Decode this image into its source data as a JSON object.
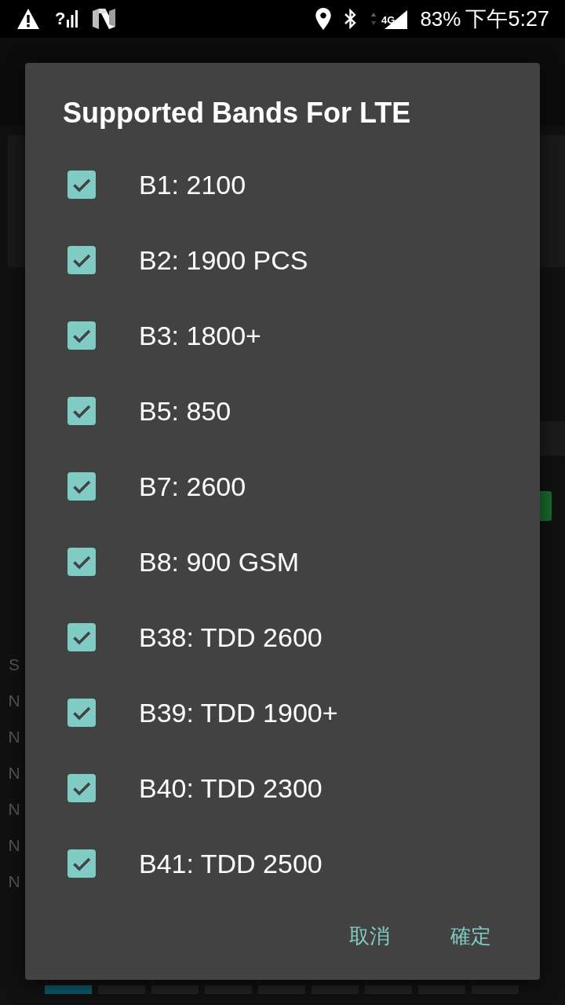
{
  "status_bar": {
    "signal_mark": "?",
    "network_type": "4G",
    "battery": "83%",
    "time": "下午5:27"
  },
  "background": {
    "side_letters": [
      "S",
      "N",
      "N",
      "N",
      "N",
      "N",
      "N"
    ],
    "page_indicators": [
      {
        "selected": true
      },
      {
        "selected": false
      },
      {
        "selected": false
      },
      {
        "selected": false
      },
      {
        "selected": false
      },
      {
        "selected": false
      },
      {
        "selected": false
      },
      {
        "selected": false
      },
      {
        "selected": false
      }
    ]
  },
  "dialog": {
    "title": "Supported Bands For LTE",
    "bands": [
      {
        "label": "B1: 2100",
        "checked": true
      },
      {
        "label": "B2: 1900 PCS",
        "checked": true
      },
      {
        "label": "B3: 1800+",
        "checked": true
      },
      {
        "label": "B5: 850",
        "checked": true
      },
      {
        "label": "B7: 2600",
        "checked": true
      },
      {
        "label": "B8: 900 GSM",
        "checked": true
      },
      {
        "label": "B38: TDD 2600",
        "checked": true
      },
      {
        "label": "B39: TDD 1900+",
        "checked": true
      },
      {
        "label": "B40: TDD 2300",
        "checked": true
      },
      {
        "label": "B41: TDD 2500",
        "checked": true
      }
    ],
    "buttons": [
      {
        "label": "取消",
        "kind": "cancel"
      },
      {
        "label": "確定",
        "kind": "confirm"
      }
    ]
  }
}
